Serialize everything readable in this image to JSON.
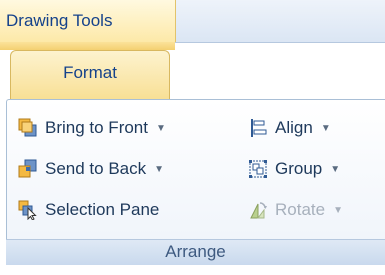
{
  "ribbon": {
    "context_title": "Drawing Tools",
    "active_tab": "Format",
    "group": {
      "label": "Arrange",
      "left_commands": [
        {
          "label": "Bring to Front",
          "has_dropdown": true,
          "icon": "bring-to-front-icon"
        },
        {
          "label": "Send to Back",
          "has_dropdown": true,
          "icon": "send-to-back-icon"
        },
        {
          "label": "Selection Pane",
          "has_dropdown": false,
          "icon": "selection-pane-icon"
        }
      ],
      "right_commands": [
        {
          "label": "Align",
          "has_dropdown": true,
          "icon": "align-icon",
          "enabled": true
        },
        {
          "label": "Group",
          "has_dropdown": true,
          "icon": "group-icon",
          "enabled": true
        },
        {
          "label": "Rotate",
          "has_dropdown": true,
          "icon": "rotate-icon",
          "enabled": false
        }
      ]
    }
  },
  "colors": {
    "contextual_header": "#fde9a8",
    "text": "#1e395b",
    "disabled_text": "#a7b0bc"
  }
}
